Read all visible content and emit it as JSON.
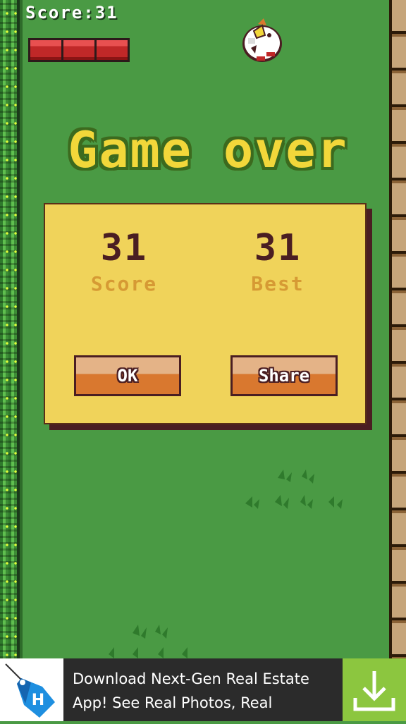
{
  "hud": {
    "score_label": "Score:31",
    "health_segments": 3
  },
  "title": "Game over",
  "panel": {
    "score_value": "31",
    "score_label": "Score",
    "best_value": "31",
    "best_label": "Best",
    "ok_label": "OK",
    "share_label": "Share"
  },
  "ad": {
    "text": "Download Next-Gen Real Estate App! See Real Photos, Real",
    "logo_icon": "price-tag-logo-icon",
    "download_icon": "download-arrow-icon"
  },
  "colors": {
    "grass": "#4a9a44",
    "panel": "#f0d35a",
    "title_fill": "#f2d73a",
    "title_outline": "#3c6a1e",
    "dark_brown": "#4a1e22",
    "label_gold": "#d69a34",
    "button_orange": "#d9782f",
    "health_red": "#c02828",
    "ad_green": "#8cc63f"
  }
}
